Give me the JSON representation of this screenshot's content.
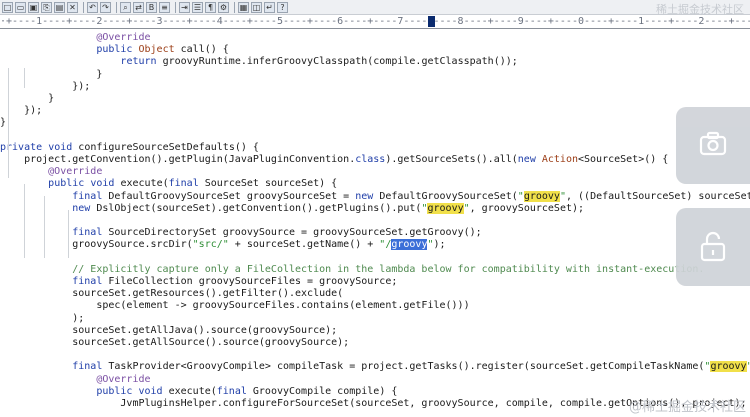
{
  "toolbar": {
    "buttons": [
      "new-icon",
      "open-icon",
      "save-icon",
      "copy-icon",
      "paste-icon",
      "close-icon",
      "undo-icon",
      "redo-icon",
      "find-icon",
      "replace-icon",
      "bold-icon",
      "align-icon",
      "indent-icon",
      "list-icon",
      "format-icon",
      "settings-icon",
      "view-icon",
      "split-icon",
      "wrap-icon",
      "help-icon"
    ],
    "watermark": "稀土掘金技术社区"
  },
  "ruler": {
    "text": "·+----1----+----2----+----3----+----4----+----5----+----6----+----7----+----8----+----9----+----0----+----1----+----2----+----3"
  },
  "code": {
    "lines": [
      [
        {
          "t": "                @Override",
          "c": "ann"
        }
      ],
      [
        {
          "t": "                "
        },
        {
          "t": "public",
          "c": "kw"
        },
        {
          "t": " "
        },
        {
          "t": "Object",
          "c": "cls"
        },
        {
          "t": " call() {"
        }
      ],
      [
        {
          "t": "                    "
        },
        {
          "t": "return",
          "c": "kw"
        },
        {
          "t": " groovyRuntime.inferGroovyClasspath(compile.getClasspath());"
        }
      ],
      [
        {
          "t": "                }"
        }
      ],
      [
        {
          "t": "            });"
        }
      ],
      [
        {
          "t": "        }"
        }
      ],
      [
        {
          "t": "    });"
        }
      ],
      [
        {
          "t": "}"
        }
      ],
      [
        {
          "t": ""
        }
      ],
      [
        {
          "t": "private",
          "c": "kw"
        },
        {
          "t": " "
        },
        {
          "t": "void",
          "c": "kw"
        },
        {
          "t": " configureSourceSetDefaults() {"
        }
      ],
      [
        {
          "t": "    project.getConvention().getPlugin(JavaPluginConvention."
        },
        {
          "t": "class",
          "c": "kw"
        },
        {
          "t": ").getSourceSets().all("
        },
        {
          "t": "new",
          "c": "kw"
        },
        {
          "t": " "
        },
        {
          "t": "Action",
          "c": "cls"
        },
        {
          "t": "<SourceSet>() {"
        }
      ],
      [
        {
          "t": "        @Override",
          "c": "ann"
        }
      ],
      [
        {
          "t": "        "
        },
        {
          "t": "public",
          "c": "kw"
        },
        {
          "t": " "
        },
        {
          "t": "void",
          "c": "kw"
        },
        {
          "t": " execute("
        },
        {
          "t": "final",
          "c": "kw"
        },
        {
          "t": " SourceSet sourceSet) {"
        }
      ],
      [
        {
          "t": "            "
        },
        {
          "t": "final",
          "c": "kw"
        },
        {
          "t": " DefaultGroovySourceSet groovySourceSet = "
        },
        {
          "t": "new",
          "c": "kw"
        },
        {
          "t": " DefaultGroovySourceSet("
        },
        {
          "t": "\"",
          "c": "str"
        },
        {
          "t": "groovy",
          "c": "hl"
        },
        {
          "t": "\"",
          "c": "str"
        },
        {
          "t": ", ((DefaultSourceSet) sourceSet)"
        }
      ],
      [
        {
          "t": "            "
        },
        {
          "t": "new",
          "c": "kw"
        },
        {
          "t": " DslObject(sourceSet).getConvention().getPlugins().put("
        },
        {
          "t": "\"",
          "c": "str"
        },
        {
          "t": "groovy",
          "c": "hl"
        },
        {
          "t": "\"",
          "c": "str"
        },
        {
          "t": ", groovySourceSet);"
        }
      ],
      [
        {
          "t": ""
        }
      ],
      [
        {
          "t": "            "
        },
        {
          "t": "final",
          "c": "kw"
        },
        {
          "t": " SourceDirectorySet groovySource = groovySourceSet.getGroovy();"
        }
      ],
      [
        {
          "t": "            groovySource.srcDir("
        },
        {
          "t": "\"src/\"",
          "c": "str"
        },
        {
          "t": " + sourceSet.getName() + "
        },
        {
          "t": "\"/",
          "c": "str"
        },
        {
          "t": "groovy",
          "c": "sel"
        },
        {
          "t": "\"",
          "c": "str"
        },
        {
          "t": ");"
        }
      ],
      [
        {
          "t": ""
        }
      ],
      [
        {
          "t": "            // Explicitly capture only a FileCollection in the lambda below for compatibility with instant-execution.",
          "c": "cmt"
        }
      ],
      [
        {
          "t": "            "
        },
        {
          "t": "final",
          "c": "kw"
        },
        {
          "t": " FileCollection groovySourceFiles = groovySource;"
        }
      ],
      [
        {
          "t": "            sourceSet.getResources().getFilter().exclude("
        }
      ],
      [
        {
          "t": "                spec(element -> groovySourceFiles.contains(element.getFile()))"
        }
      ],
      [
        {
          "t": "            );"
        }
      ],
      [
        {
          "t": "            sourceSet.getAllJava().source(groovySource);"
        }
      ],
      [
        {
          "t": "            sourceSet.getAllSource().source(groovySource);"
        }
      ],
      [
        {
          "t": ""
        }
      ],
      [
        {
          "t": "            "
        },
        {
          "t": "final",
          "c": "kw"
        },
        {
          "t": " TaskProvider<GroovyCompile> compileTask = project.getTasks().register(sourceSet.getCompileTaskName("
        },
        {
          "t": "\"",
          "c": "str"
        },
        {
          "t": "groovy",
          "c": "hl"
        },
        {
          "t": "\"",
          "c": "str"
        },
        {
          "t": ")"
        }
      ],
      [
        {
          "t": "                @Override",
          "c": "ann"
        }
      ],
      [
        {
          "t": "                "
        },
        {
          "t": "public",
          "c": "kw"
        },
        {
          "t": " "
        },
        {
          "t": "void",
          "c": "kw"
        },
        {
          "t": " execute("
        },
        {
          "t": "final",
          "c": "kw"
        },
        {
          "t": " GroovyCompile compile) {"
        }
      ],
      [
        {
          "t": "                    JvmPluginsHelper.configureForSourceSet(sourceSet, groovySource, compile, compile.getOptions(), project);"
        }
      ]
    ]
  },
  "overlay": {
    "camera_icon": "camera-icon",
    "unlock_icon": "unlock-icon",
    "watermark": "@稀土掘金技术社区"
  }
}
